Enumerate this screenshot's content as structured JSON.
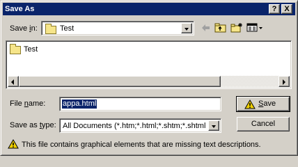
{
  "window": {
    "title": "Save As",
    "help_button": "?",
    "close_button": "X"
  },
  "save_in": {
    "label_pre": "Save ",
    "label_key": "i",
    "label_post": "n:",
    "value": "Test",
    "icon": "folder-icon"
  },
  "toolbar": {
    "icons": [
      "back-arrow-icon",
      "up-folder-icon",
      "new-folder-icon",
      "view-menu-icon"
    ]
  },
  "file_list": {
    "items": [
      {
        "name": "Test",
        "icon": "folder-icon"
      }
    ]
  },
  "file_name": {
    "label_pre": "File ",
    "label_key": "n",
    "label_post": "ame:",
    "value": "appa.html"
  },
  "save_as_type": {
    "label_pre": "Save as ",
    "label_key": "t",
    "label_post": "ype:",
    "value": "All Documents (*.htm;*.html;*.shtm;*.shtml;*.sl"
  },
  "buttons": {
    "save_key": "S",
    "save_rest": "ave",
    "cancel": "Cancel"
  },
  "warning": {
    "icon": "warning-icon",
    "text": "This file contains graphical elements that are missing text descriptions."
  },
  "colors": {
    "titlebar": "#0a246a",
    "face": "#d4d0c8",
    "warning": "#f0d000"
  }
}
